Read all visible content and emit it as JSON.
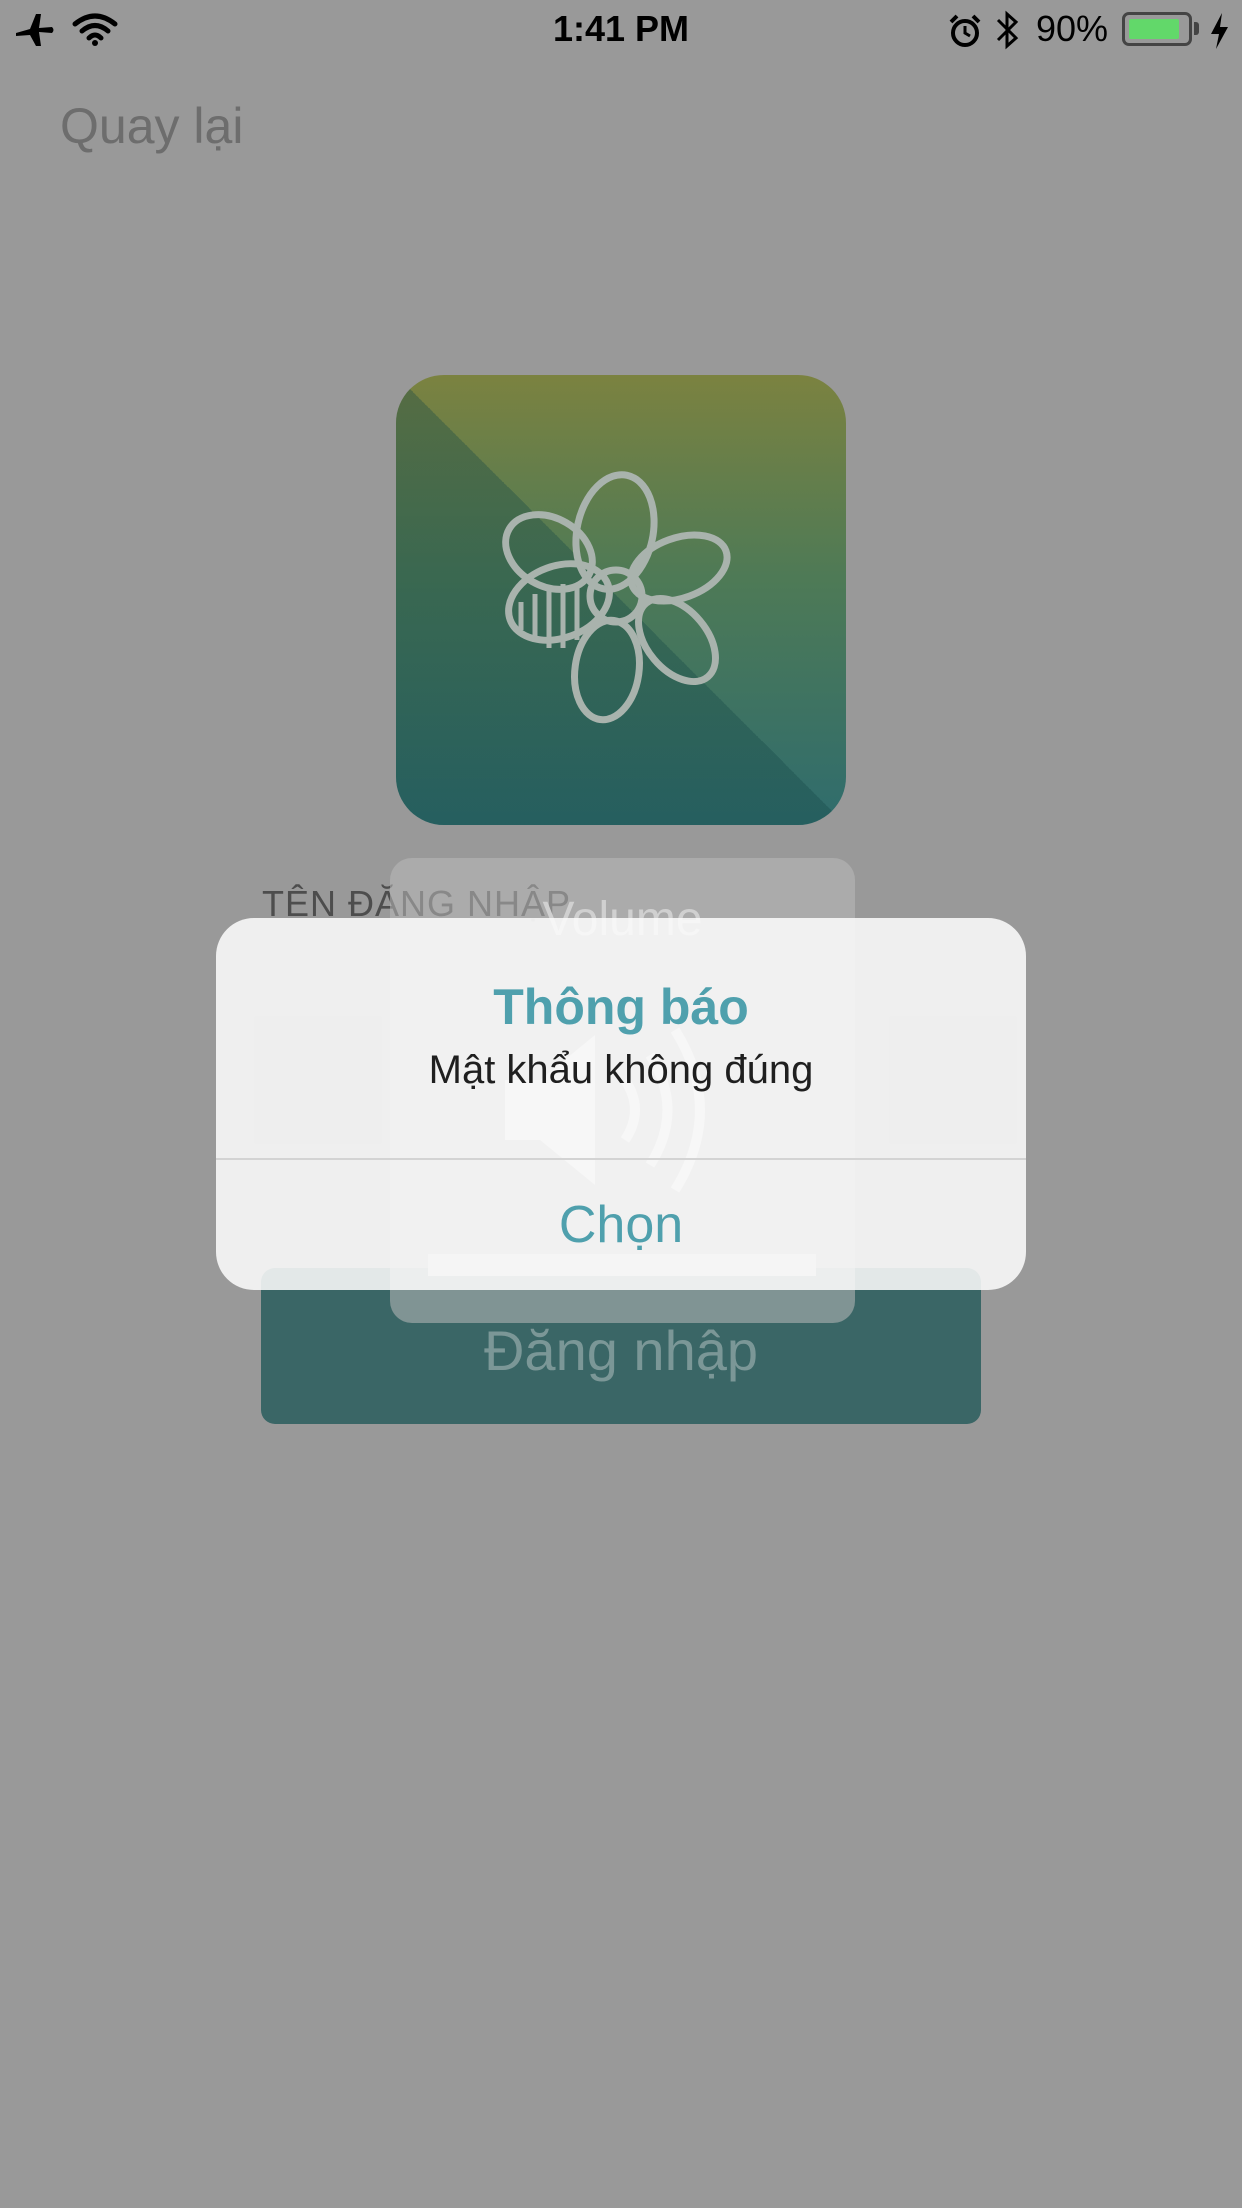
{
  "status_bar": {
    "time": "1:41 PM",
    "battery_percent": "90%",
    "battery_level": 0.9,
    "icons": [
      "airplane-icon",
      "wifi-icon",
      "alarm-icon",
      "bluetooth-icon",
      "battery-icon",
      "charging-icon"
    ]
  },
  "nav": {
    "back_label": "Quay lại"
  },
  "form": {
    "username_label": "TÊN ĐĂNG NHẬP",
    "login_button": "Đăng nhập"
  },
  "volume_hud": {
    "label": "Volume",
    "icon": "speaker-icon"
  },
  "alert": {
    "title": "Thông báo",
    "message": "Mật khẩu không đúng",
    "button": "Chọn"
  },
  "colors": {
    "overlay": "#999999",
    "accent": "#4fa0ad",
    "login_button": "#3a6666",
    "battery_fill": "#62d86a"
  }
}
